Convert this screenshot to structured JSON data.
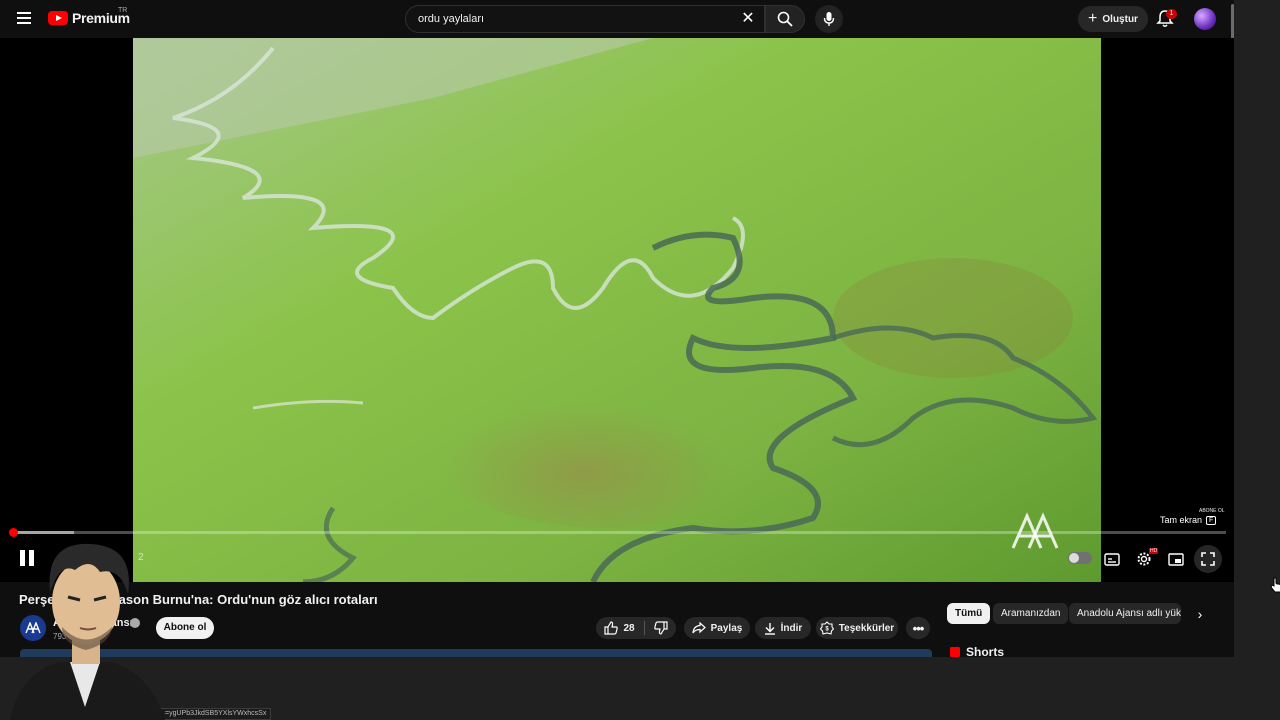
{
  "header": {
    "logo_text": "Premium",
    "country_code": "TR",
    "search_value": "ordu yaylaları",
    "create_label": "Oluştur",
    "notification_count": "1"
  },
  "player": {
    "time_text": "2",
    "fullscreen_tooltip": "Tam ekran",
    "fullscreen_key": "F",
    "watermark_text": "ABONE OL",
    "progress_played_fraction": 0.002,
    "progress_loaded_fraction": 0.052
  },
  "video": {
    "title": "Perşembe'den Yason Burnu'na: Ordu'nun göz alıcı rotaları",
    "channel_name": "Anadolu Ajansı",
    "subscriber_count": "793 B abone",
    "subscribe_label": "Abone ol",
    "like_count": "28",
    "share_label": "Paylaş",
    "download_label": "İndir",
    "thanks_label": "Teşekkürler"
  },
  "sidebar": {
    "chips": [
      "Tümü",
      "Aramanızdan",
      "Anadolu Ajansı adlı yüklemeler"
    ],
    "shorts_heading": "Shorts"
  },
  "status_bar": {
    "url_fragment": "=ygUPb3JkdSB5YXlsYWxhcsSx"
  },
  "colors": {
    "brand_red": "#ff0000",
    "background": "#0f0f0f",
    "button_bg": "#272727"
  }
}
